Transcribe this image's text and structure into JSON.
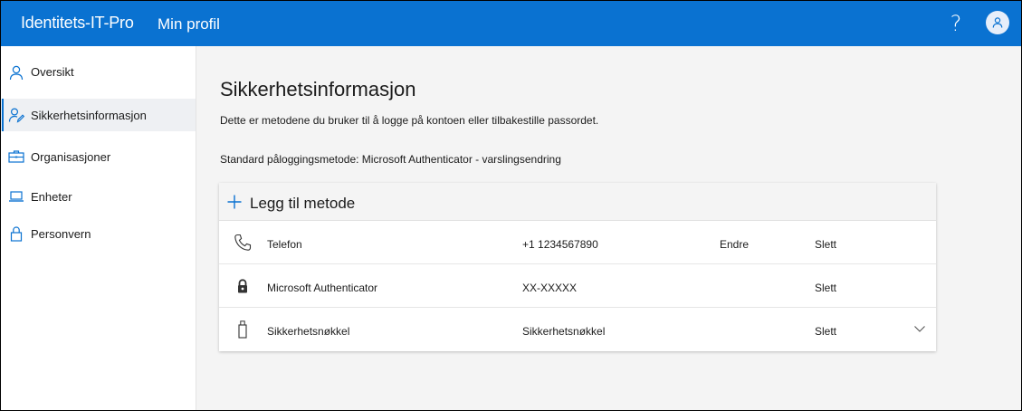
{
  "header": {
    "app_title": "Identitets-IT-Pro",
    "page_name": "Min profil",
    "help_label": "?",
    "accent_color": "#0a72d1"
  },
  "sidebar": {
    "items": [
      {
        "label": "Oversikt",
        "icon": "person-icon",
        "active": false
      },
      {
        "label": "Sikkerhetsinformasjon",
        "icon": "person-edit-icon",
        "active": true
      },
      {
        "label": "Organisasjoner",
        "icon": "briefcase-icon",
        "active": false
      },
      {
        "label": "Enheter",
        "icon": "laptop-icon",
        "active": false
      },
      {
        "label": "Personvern",
        "icon": "lock-icon",
        "active": false
      }
    ]
  },
  "main": {
    "title": "Sikkerhetsinformasjon",
    "description": "Dette er metodene du bruker til å logge på kontoen eller tilbakestille passordet.",
    "default_method": "Standard påloggingsmetode: Microsoft Authenticator - varslingsendring",
    "add_method_label": "Legg til metode",
    "methods": [
      {
        "name": "Telefon",
        "value": "+1 1234567890",
        "edit": "Endre",
        "delete": "Slett",
        "icon": "phone-icon"
      },
      {
        "name": "Microsoft Authenticator",
        "value": "XX-XXXXX",
        "edit": "",
        "delete": "Slett",
        "icon": "authenticator-lock-icon"
      },
      {
        "name": "Sikkerhetsnøkkel",
        "value": "Sikkerhetsnøkkel",
        "edit": "",
        "delete": "Slett",
        "icon": "usb-key-icon"
      }
    ]
  }
}
